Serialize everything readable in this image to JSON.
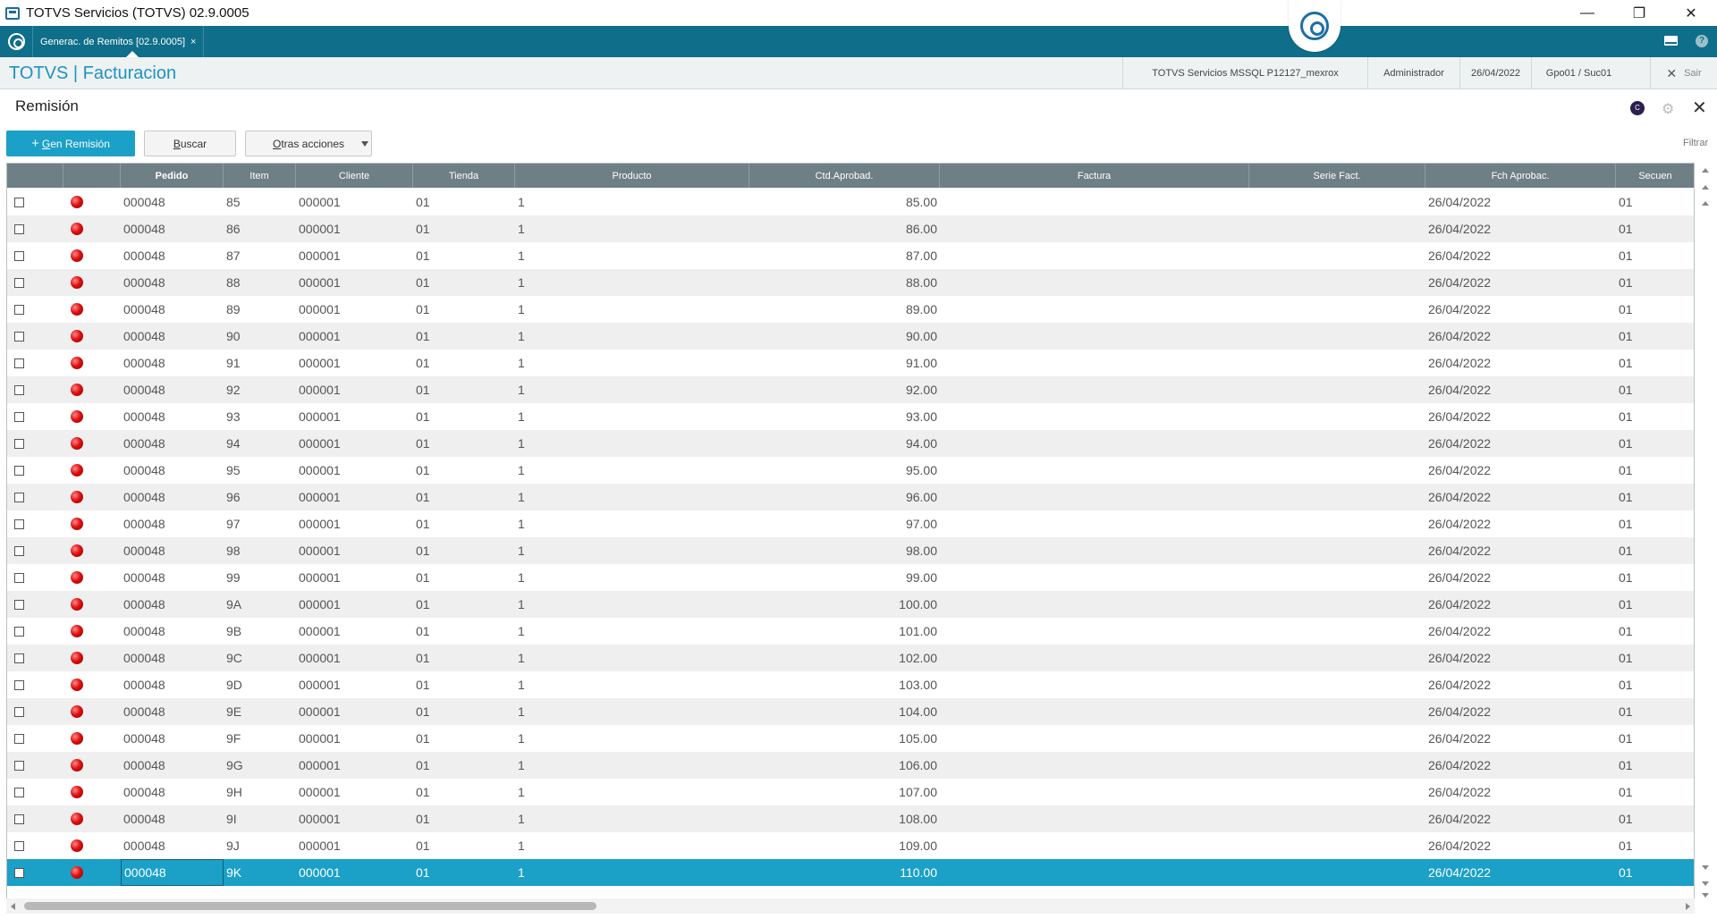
{
  "window": {
    "title": "TOTVS Servicios (TOTVS) 02.9.0005",
    "minimize": "—",
    "restore": "❐",
    "close": "✕"
  },
  "tabs": [
    {
      "label": "Generac. de Remitos [02.9.0005]",
      "close": "×"
    }
  ],
  "module": {
    "title": "TOTVS | Facturacion",
    "environment": "TOTVS Servicios MSSQL P12127_mexrox",
    "user": "Administrador",
    "date": "26/04/2022",
    "branch": "Gpo01 / Suc01",
    "exit_label": "Sair",
    "exit_icon": "✕"
  },
  "page": {
    "title": "Remisión",
    "badge": "C",
    "gear": "⚙",
    "close": "✕"
  },
  "toolbar": {
    "primary": {
      "plus": "+",
      "prefix": "",
      "underlined": "G",
      "rest": "en Remisión"
    },
    "buscar": {
      "underlined": "B",
      "rest": "uscar"
    },
    "otras": {
      "underlined": "O",
      "rest": "tras acciones"
    },
    "filter_label": "Filtrar"
  },
  "grid": {
    "columns": [
      "",
      "",
      "Pedido",
      "Item",
      "Cliente",
      "Tienda",
      "Producto",
      "Ctd.Aprobad.",
      "Factura",
      "Serie Fact.",
      "Fch Aprobac.",
      "Secuen"
    ],
    "rows": [
      {
        "pedido": "000048",
        "item": "85",
        "cliente": "000001",
        "tienda": "01",
        "producto": "1",
        "ctd": "85.00",
        "factura": "",
        "serie": "",
        "fecha": "26/04/2022",
        "secuen": "01"
      },
      {
        "pedido": "000048",
        "item": "86",
        "cliente": "000001",
        "tienda": "01",
        "producto": "1",
        "ctd": "86.00",
        "factura": "",
        "serie": "",
        "fecha": "26/04/2022",
        "secuen": "01"
      },
      {
        "pedido": "000048",
        "item": "87",
        "cliente": "000001",
        "tienda": "01",
        "producto": "1",
        "ctd": "87.00",
        "factura": "",
        "serie": "",
        "fecha": "26/04/2022",
        "secuen": "01"
      },
      {
        "pedido": "000048",
        "item": "88",
        "cliente": "000001",
        "tienda": "01",
        "producto": "1",
        "ctd": "88.00",
        "factura": "",
        "serie": "",
        "fecha": "26/04/2022",
        "secuen": "01"
      },
      {
        "pedido": "000048",
        "item": "89",
        "cliente": "000001",
        "tienda": "01",
        "producto": "1",
        "ctd": "89.00",
        "factura": "",
        "serie": "",
        "fecha": "26/04/2022",
        "secuen": "01"
      },
      {
        "pedido": "000048",
        "item": "90",
        "cliente": "000001",
        "tienda": "01",
        "producto": "1",
        "ctd": "90.00",
        "factura": "",
        "serie": "",
        "fecha": "26/04/2022",
        "secuen": "01"
      },
      {
        "pedido": "000048",
        "item": "91",
        "cliente": "000001",
        "tienda": "01",
        "producto": "1",
        "ctd": "91.00",
        "factura": "",
        "serie": "",
        "fecha": "26/04/2022",
        "secuen": "01"
      },
      {
        "pedido": "000048",
        "item": "92",
        "cliente": "000001",
        "tienda": "01",
        "producto": "1",
        "ctd": "92.00",
        "factura": "",
        "serie": "",
        "fecha": "26/04/2022",
        "secuen": "01"
      },
      {
        "pedido": "000048",
        "item": "93",
        "cliente": "000001",
        "tienda": "01",
        "producto": "1",
        "ctd": "93.00",
        "factura": "",
        "serie": "",
        "fecha": "26/04/2022",
        "secuen": "01"
      },
      {
        "pedido": "000048",
        "item": "94",
        "cliente": "000001",
        "tienda": "01",
        "producto": "1",
        "ctd": "94.00",
        "factura": "",
        "serie": "",
        "fecha": "26/04/2022",
        "secuen": "01"
      },
      {
        "pedido": "000048",
        "item": "95",
        "cliente": "000001",
        "tienda": "01",
        "producto": "1",
        "ctd": "95.00",
        "factura": "",
        "serie": "",
        "fecha": "26/04/2022",
        "secuen": "01"
      },
      {
        "pedido": "000048",
        "item": "96",
        "cliente": "000001",
        "tienda": "01",
        "producto": "1",
        "ctd": "96.00",
        "factura": "",
        "serie": "",
        "fecha": "26/04/2022",
        "secuen": "01"
      },
      {
        "pedido": "000048",
        "item": "97",
        "cliente": "000001",
        "tienda": "01",
        "producto": "1",
        "ctd": "97.00",
        "factura": "",
        "serie": "",
        "fecha": "26/04/2022",
        "secuen": "01"
      },
      {
        "pedido": "000048",
        "item": "98",
        "cliente": "000001",
        "tienda": "01",
        "producto": "1",
        "ctd": "98.00",
        "factura": "",
        "serie": "",
        "fecha": "26/04/2022",
        "secuen": "01"
      },
      {
        "pedido": "000048",
        "item": "99",
        "cliente": "000001",
        "tienda": "01",
        "producto": "1",
        "ctd": "99.00",
        "factura": "",
        "serie": "",
        "fecha": "26/04/2022",
        "secuen": "01"
      },
      {
        "pedido": "000048",
        "item": "9A",
        "cliente": "000001",
        "tienda": "01",
        "producto": "1",
        "ctd": "100.00",
        "factura": "",
        "serie": "",
        "fecha": "26/04/2022",
        "secuen": "01"
      },
      {
        "pedido": "000048",
        "item": "9B",
        "cliente": "000001",
        "tienda": "01",
        "producto": "1",
        "ctd": "101.00",
        "factura": "",
        "serie": "",
        "fecha": "26/04/2022",
        "secuen": "01"
      },
      {
        "pedido": "000048",
        "item": "9C",
        "cliente": "000001",
        "tienda": "01",
        "producto": "1",
        "ctd": "102.00",
        "factura": "",
        "serie": "",
        "fecha": "26/04/2022",
        "secuen": "01"
      },
      {
        "pedido": "000048",
        "item": "9D",
        "cliente": "000001",
        "tienda": "01",
        "producto": "1",
        "ctd": "103.00",
        "factura": "",
        "serie": "",
        "fecha": "26/04/2022",
        "secuen": "01"
      },
      {
        "pedido": "000048",
        "item": "9E",
        "cliente": "000001",
        "tienda": "01",
        "producto": "1",
        "ctd": "104.00",
        "factura": "",
        "serie": "",
        "fecha": "26/04/2022",
        "secuen": "01"
      },
      {
        "pedido": "000048",
        "item": "9F",
        "cliente": "000001",
        "tienda": "01",
        "producto": "1",
        "ctd": "105.00",
        "factura": "",
        "serie": "",
        "fecha": "26/04/2022",
        "secuen": "01"
      },
      {
        "pedido": "000048",
        "item": "9G",
        "cliente": "000001",
        "tienda": "01",
        "producto": "1",
        "ctd": "106.00",
        "factura": "",
        "serie": "",
        "fecha": "26/04/2022",
        "secuen": "01"
      },
      {
        "pedido": "000048",
        "item": "9H",
        "cliente": "000001",
        "tienda": "01",
        "producto": "1",
        "ctd": "107.00",
        "factura": "",
        "serie": "",
        "fecha": "26/04/2022",
        "secuen": "01"
      },
      {
        "pedido": "000048",
        "item": "9I",
        "cliente": "000001",
        "tienda": "01",
        "producto": "1",
        "ctd": "108.00",
        "factura": "",
        "serie": "",
        "fecha": "26/04/2022",
        "secuen": "01"
      },
      {
        "pedido": "000048",
        "item": "9J",
        "cliente": "000001",
        "tienda": "01",
        "producto": "1",
        "ctd": "109.00",
        "factura": "",
        "serie": "",
        "fecha": "26/04/2022",
        "secuen": "01"
      },
      {
        "pedido": "000048",
        "item": "9K",
        "cliente": "000001",
        "tienda": "01",
        "producto": "1",
        "ctd": "110.00",
        "factura": "",
        "serie": "",
        "fecha": "26/04/2022",
        "secuen": "01",
        "selected": true
      }
    ]
  },
  "colors": {
    "brand": "#0f6e89",
    "accent": "#1ba0c7",
    "header_bg": "#6e7f86",
    "status_red": "#e01010"
  },
  "icons": {
    "app": "app-icon",
    "home": "home-icon",
    "chat": "chat-icon",
    "mail": "mail-icon",
    "help": "help-icon",
    "status": "red-status-icon"
  }
}
